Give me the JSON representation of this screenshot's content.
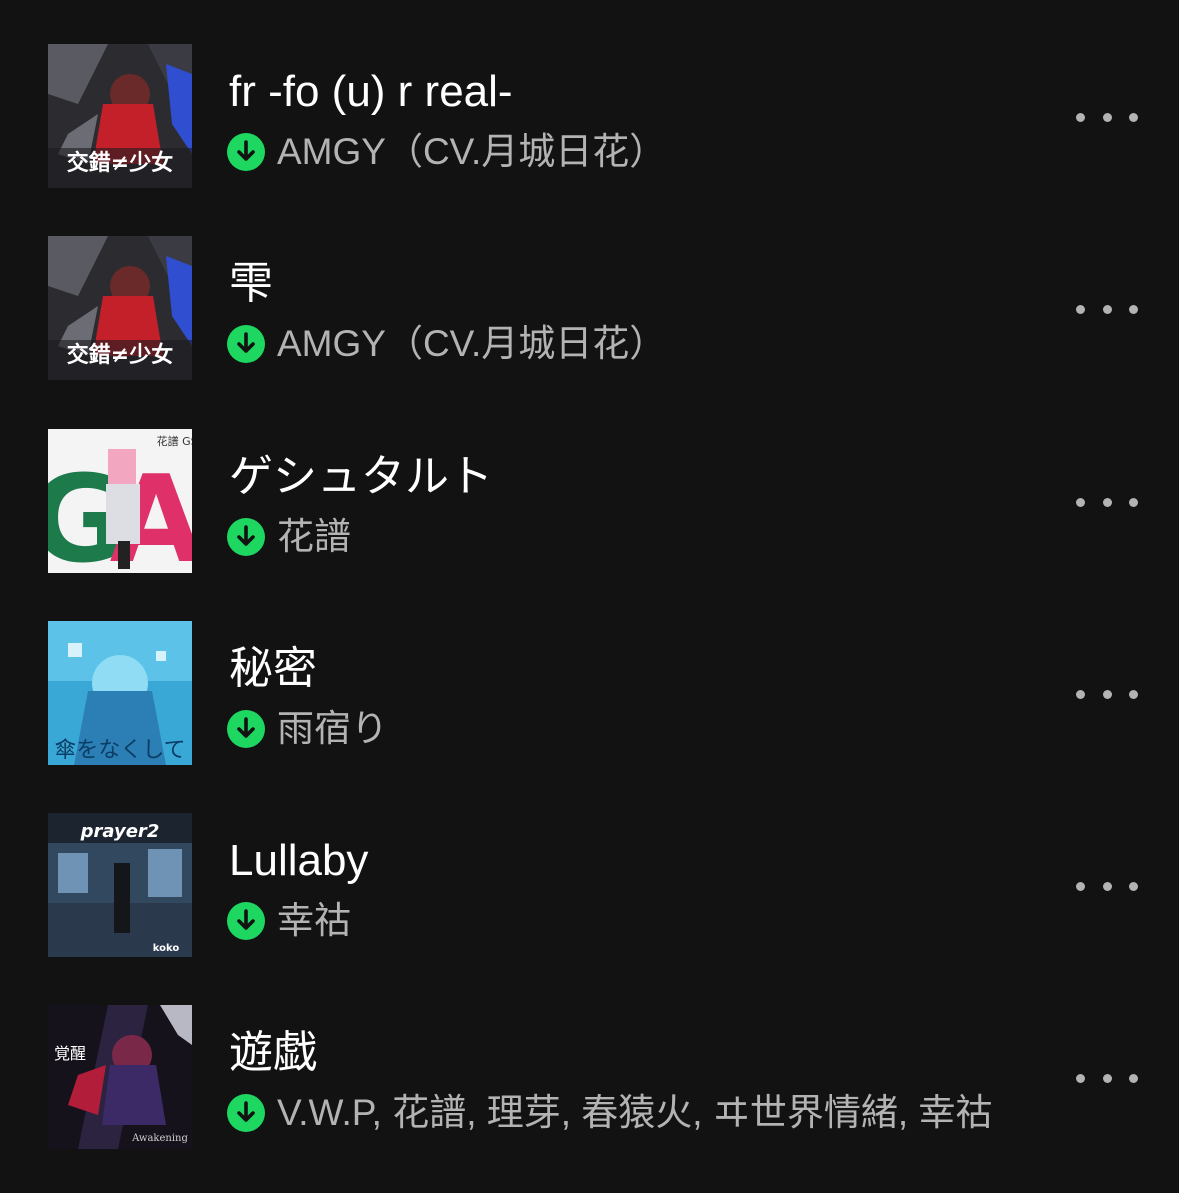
{
  "colors": {
    "background": "#121212",
    "title": "#ffffff",
    "artist": "#b3b3b3",
    "download_accent": "#1ed760"
  },
  "icons": {
    "download": "download-arrow-circle-icon",
    "more": "more-horizontal-icon"
  },
  "tracks": [
    {
      "title": "fr -fo (u) r real-",
      "artist": "AMGY（CV.月城日花）",
      "cover": {
        "text": "交錯≠少女"
      }
    },
    {
      "title": "雫",
      "artist": "AMGY（CV.月城日花）",
      "cover": {
        "text": "交錯≠少女"
      }
    },
    {
      "title": "ゲシュタルト",
      "artist": "花譜",
      "cover": {
        "text": "GSA",
        "side_text": "花譜 GSA"
      }
    },
    {
      "title": "秘密",
      "artist": "雨宿り",
      "cover": {
        "text": "傘をなくして"
      }
    },
    {
      "title": "Lullaby",
      "artist": "幸祜",
      "cover": {
        "text": "prayer2",
        "bottom_text": "koko"
      }
    },
    {
      "title": "遊戯",
      "artist": "V.W.P, 花譜, 理芽, 春猿火, ヰ世界情緒, 幸祜",
      "cover": {
        "text": "覚醒",
        "bottom_text": "Awakening"
      }
    }
  ]
}
